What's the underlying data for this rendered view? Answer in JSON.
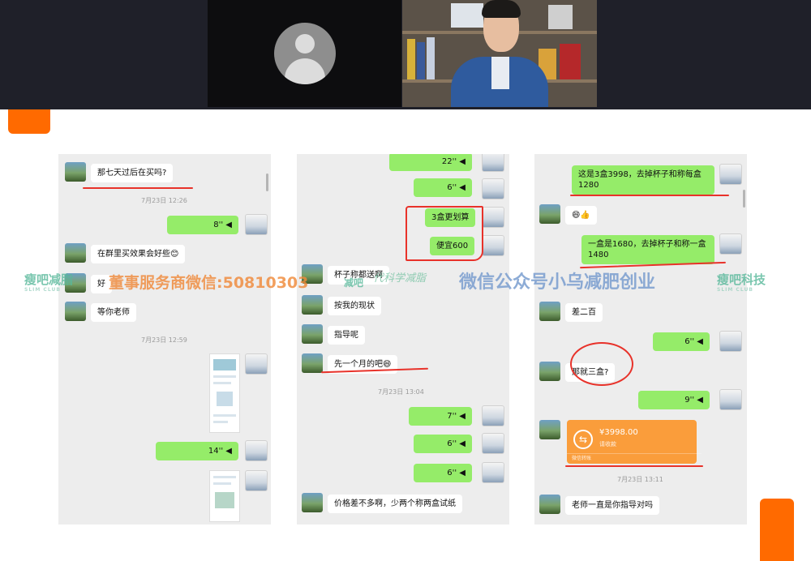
{
  "watermarks": {
    "brand_left": "瘦吧减脂",
    "brand_left_sub": "SLIM CLUB",
    "contact": "董事服务商微信:50810303",
    "script_text": "代科学减脂",
    "wechat_account": "微信公众号小乌减肥创业",
    "brand_right": "瘦吧科技",
    "brand_right_sub": "SLIM CLUB",
    "mark_small": "减吧"
  },
  "chat1": {
    "m1": "那七天过后在买吗?",
    "t1": "7月23日 12:26",
    "v1": "8''",
    "m2": "在群里买效果会好些😊",
    "m3_partial": "好",
    "m4": "等你老师",
    "t2": "7月23日 12:59",
    "v2": "14''"
  },
  "chat2": {
    "v1": "22''",
    "v2": "6''",
    "m1": "3盒更划算",
    "m2": "便宜600",
    "m3": "杯子称都送啊",
    "m4": "按我的现状",
    "m5": "指导呢",
    "m6": "先一个月的吧😄",
    "t1": "7月23日 13:04",
    "v3": "7''",
    "v4": "6''",
    "v5": "6''",
    "m7": "价格差不多啊，少两个称两盒试纸"
  },
  "chat3": {
    "m1": "这是3盒3998，去掉杯子和称每盒1280",
    "m2": "😄👍",
    "m3": "一盒是1680，去掉杯子和称一盒1480",
    "m4": "差二百",
    "v1": "6''",
    "m5": "那就三盒?",
    "v2": "9''",
    "transfer_amount": "¥3998.00",
    "transfer_status": "请收款",
    "transfer_footer": "微信转账",
    "t1": "7月23日 13:11",
    "m6": "老师一直是你指导对吗"
  }
}
